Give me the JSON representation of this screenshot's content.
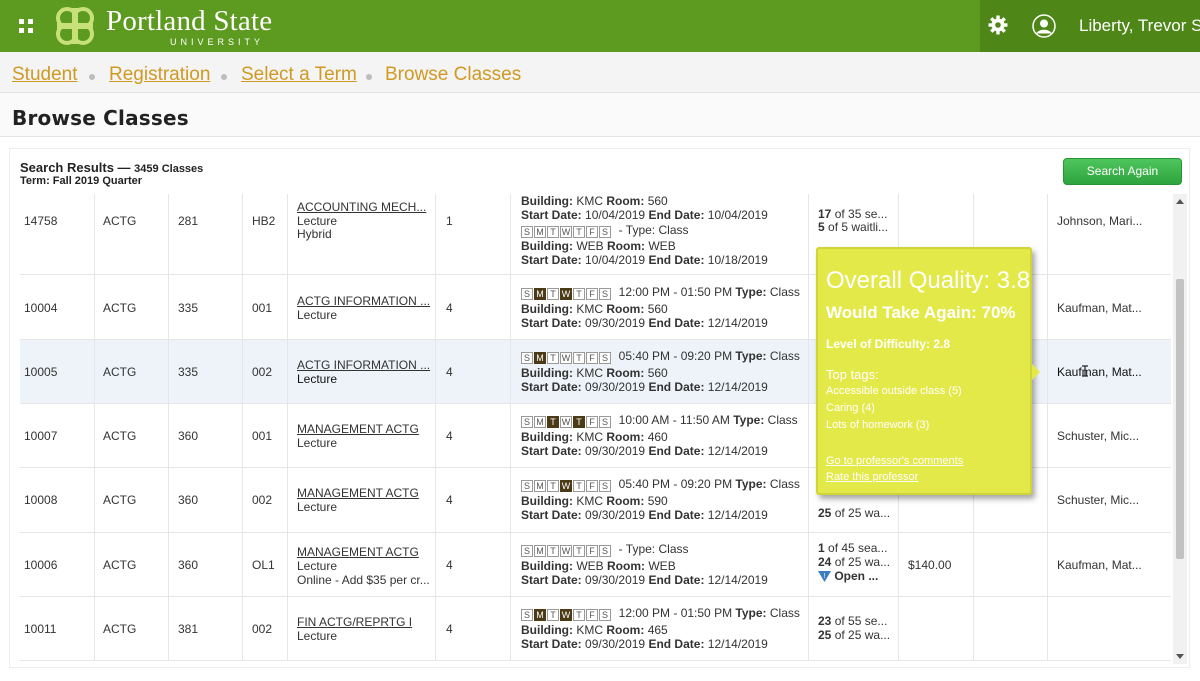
{
  "header": {
    "logo_text": "Portland State",
    "logo_sub": "UNIVERSITY",
    "user_name": "Liberty, Trevor S",
    "menu_icon": "grid-icon",
    "settings_icon": "gear-icon",
    "user_icon": "user-icon",
    "brand_color": "#5d9a20"
  },
  "breadcrumb": {
    "items": [
      "Student",
      "Registration",
      "Select a Term",
      "Browse Classes"
    ]
  },
  "page_title": "Browse Classes",
  "results": {
    "title": "Search Results —",
    "count": "3459 Classes",
    "term": "Term: Fall 2019 Quarter",
    "search_again": "Search Again"
  },
  "rows": [
    {
      "crn": "14758",
      "subject": "ACTG",
      "course": "281",
      "section": "HB2",
      "title": "ACCOUNTING MECH...",
      "type": "Lecture",
      "extra": "Hybrid",
      "credits": "1",
      "seats": "17",
      "seats_rest": "of 35 se...",
      "wait": "5",
      "wait_rest": "of 5 waitli...",
      "instructor": "Johnson, Mari..."
    },
    {
      "crn": "10004",
      "subject": "ACTG",
      "course": "335",
      "section": "001",
      "title": "ACTG INFORMATION ...",
      "type": "Lecture",
      "credits": "4",
      "time": "12:00 PM - 01:50 PM",
      "building": "KMC",
      "room": "560",
      "start": "09/30/2019",
      "end": "12/14/2019",
      "instructor": "Kaufman, Mat..."
    },
    {
      "crn": "10005",
      "subject": "ACTG",
      "course": "335",
      "section": "002",
      "title": "ACTG INFORMATION ...",
      "type": "Lecture",
      "credits": "4",
      "time": "05:40 PM - 09:20 PM",
      "building": "KMC",
      "room": "560",
      "start": "09/30/2019",
      "end": "12/14/2019",
      "instructor": "Kaufman, Mat..."
    },
    {
      "crn": "10007",
      "subject": "ACTG",
      "course": "360",
      "section": "001",
      "title": "MANAGEMENT ACTG",
      "type": "Lecture",
      "credits": "4",
      "time": "10:00 AM - 11:50 AM",
      "building": "KMC",
      "room": "460",
      "start": "09/30/2019",
      "end": "12/14/2019",
      "instructor": "Schuster, Mic..."
    },
    {
      "crn": "10008",
      "subject": "ACTG",
      "course": "360",
      "section": "002",
      "title": "MANAGEMENT ACTG",
      "type": "Lecture",
      "credits": "4",
      "time": "05:40 PM - 09:20 PM",
      "building": "KMC",
      "room": "590",
      "start": "09/30/2019",
      "end": "12/14/2019",
      "wait": "25",
      "wait_rest": "of 25 wa...",
      "instructor": "Schuster, Mic..."
    },
    {
      "crn": "10006",
      "subject": "ACTG",
      "course": "360",
      "section": "OL1",
      "title": "MANAGEMENT ACTG",
      "type": "Lecture",
      "extra": "Online - Add $35 per cr...",
      "credits": "4",
      "time": "",
      "building": "WEB",
      "room": "WEB",
      "start": "09/30/2019",
      "end": "12/14/2019",
      "seats": "1",
      "seats_rest": "of 45 sea...",
      "wait": "24",
      "wait_rest": "of 25 wa...",
      "status": "Open ...",
      "fee": "$140.00",
      "instructor": "Kaufman, Mat..."
    },
    {
      "crn": "10011",
      "subject": "ACTG",
      "course": "381",
      "section": "002",
      "title": "FIN ACTG/REPRTG I",
      "type": "Lecture",
      "credits": "4",
      "time": "12:00 PM - 01:50 PM",
      "building": "KMC",
      "room": "465",
      "start": "09/30/2019",
      "end": "12/14/2019",
      "seats": "23",
      "seats_rest": "of 55 se...",
      "wait": "25",
      "wait_rest": "of 25 wa...",
      "instructor": ""
    }
  ],
  "row0_sched": {
    "building1": "KMC",
    "room1": "560",
    "start1": "10/04/2019",
    "end1": "10/04/2019",
    "building2": "WEB",
    "room2": "WEB",
    "start2": "10/04/2019",
    "end2": "10/18/2019"
  },
  "labels": {
    "building": "Building:",
    "room": "Room:",
    "start_date": "Start Date:",
    "end_date": "End Date:",
    "type": "Type:",
    "type_value": "Class",
    "dash_type": "- Type:"
  },
  "rating_popup": {
    "overall": "Overall Quality: 3.8",
    "would_take": "Would Take Again: 70%",
    "difficulty": "Level of Difficulty: 2.8",
    "top_tags": "Top tags:",
    "tags": [
      "Accessible outside class (5)",
      "Caring (4)",
      "Lots of homework (3)"
    ],
    "link_comments": "Go to professor's comments",
    "link_rate": "Rate this professor",
    "color": "#e4e94a"
  }
}
